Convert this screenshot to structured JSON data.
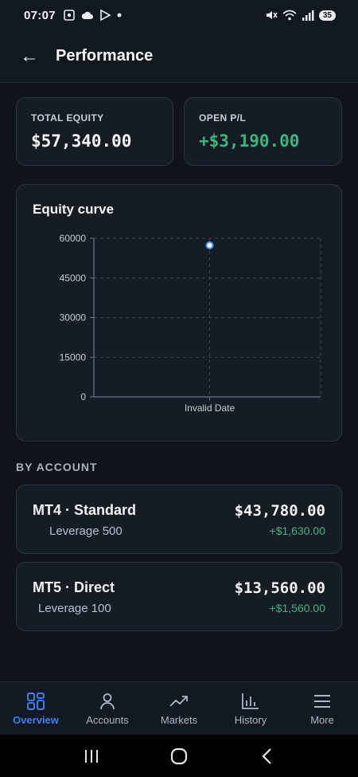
{
  "status_bar": {
    "time": "07:07",
    "battery": "35"
  },
  "header": {
    "title": "Performance",
    "back_icon": "←"
  },
  "stats": {
    "total_equity": {
      "label": "TOTAL EQUITY",
      "value": "$57,340.00"
    },
    "open_pl": {
      "label": "OPEN P/L",
      "value": "+$3,190.00"
    }
  },
  "chart_card": {
    "title": "Equity curve"
  },
  "chart_data": {
    "type": "scatter",
    "title": "Equity curve",
    "categories": [
      "Invalid Date"
    ],
    "x": [
      "Invalid Date"
    ],
    "series": [
      {
        "values": [
          57340
        ]
      }
    ],
    "ylim": [
      0,
      60000
    ],
    "yticks": [
      "0",
      "15000",
      "30000",
      "45000",
      "60000"
    ],
    "xticks": [
      "Invalid Date"
    ],
    "grid": true,
    "colors": {
      "point": "#4a8ef5",
      "grid": "#3a4450",
      "axis": "#6b7682"
    }
  },
  "by_account": {
    "label": "BY ACCOUNT",
    "accounts": [
      {
        "name": "MT4 · Standard",
        "leverage": "Leverage 500",
        "balance": "$43,780.00",
        "pl": "+$1,630.00"
      },
      {
        "name": "MT5 · Direct",
        "leverage": "Leverage 100",
        "balance": "$13,560.00",
        "pl": "+$1,560.00"
      }
    ]
  },
  "nav": {
    "items": [
      {
        "label": "Overview",
        "icon": "grid-icon",
        "active": true
      },
      {
        "label": "Accounts",
        "icon": "user-icon"
      },
      {
        "label": "Markets",
        "icon": "trending-up-icon"
      },
      {
        "label": "History",
        "icon": "bar-chart-icon"
      },
      {
        "label": "More",
        "icon": "menu-icon"
      }
    ]
  },
  "colors": {
    "accent": "#3d7df0",
    "positive": "#3fb37f",
    "background": "#0f141b",
    "card": "#151c25"
  }
}
